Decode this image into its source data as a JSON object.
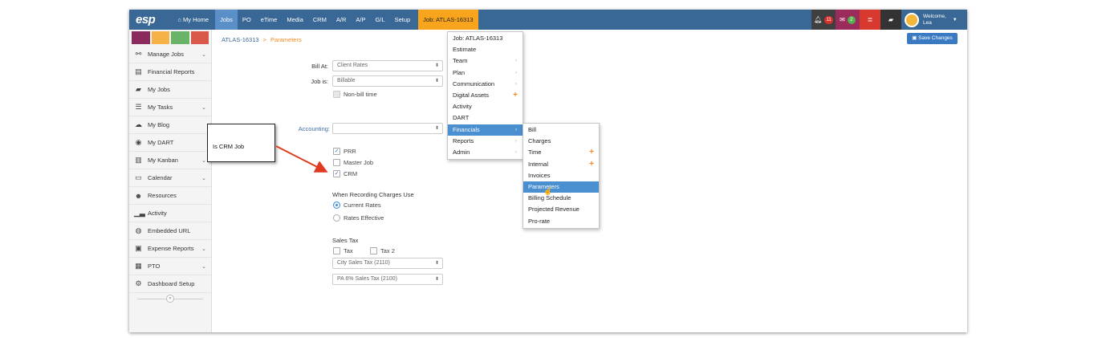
{
  "nav": {
    "logo": "esp",
    "home": "My Home",
    "items": [
      "Jobs",
      "PO",
      "eTime",
      "Media",
      "CRM",
      "A/R",
      "A/P",
      "G/L",
      "Setup"
    ],
    "job_tag": "Job: ATLAS-16313",
    "notif_count": "11",
    "mail_count": "2",
    "welcome_line1": "Welcome,",
    "welcome_line2": "Lea"
  },
  "sidebar": {
    "swatch_colors": [
      "#8b2a5c",
      "#f7b247",
      "#6ab46a",
      "#d9594a"
    ],
    "items": [
      {
        "label": "Manage Jobs",
        "icon": "sitemap-icon",
        "glyph": "⚯",
        "chevron": true
      },
      {
        "label": "Financial Reports",
        "icon": "report-icon",
        "glyph": "▤",
        "chevron": false
      },
      {
        "label": "My Jobs",
        "icon": "folder-icon",
        "glyph": "▰",
        "chevron": false
      },
      {
        "label": "My Tasks",
        "icon": "tasks-icon",
        "glyph": "☰",
        "chevron": true
      },
      {
        "label": "My Blog",
        "icon": "comments-icon",
        "glyph": "☁",
        "chevron": false
      },
      {
        "label": "My DART",
        "icon": "dart-icon",
        "glyph": "◉",
        "chevron": false
      },
      {
        "label": "My Kanban",
        "icon": "kanban-icon",
        "glyph": "▥",
        "chevron": true
      },
      {
        "label": "Calendar",
        "icon": "calendar-icon",
        "glyph": "▭",
        "chevron": true
      },
      {
        "label": "Resources",
        "icon": "users-icon",
        "glyph": "☻",
        "chevron": false
      },
      {
        "label": "Activity",
        "icon": "activity-icon",
        "glyph": "▁▃",
        "chevron": false
      },
      {
        "label": "Embedded URL",
        "icon": "globe-icon",
        "glyph": "◍",
        "chevron": false
      },
      {
        "label": "Expense Reports",
        "icon": "money-icon",
        "glyph": "▣",
        "chevron": true
      },
      {
        "label": "PTO",
        "icon": "pto-calendar-icon",
        "glyph": "▦",
        "chevron": true
      },
      {
        "label": "Dashboard Setup",
        "icon": "cogs-icon",
        "glyph": "⚙",
        "chevron": false
      }
    ],
    "collapse_glyph": "«"
  },
  "breadcrumb": {
    "job": "ATLAS-16313",
    "sep": ">",
    "current": "Parameters"
  },
  "save_label": "Save Changes",
  "form": {
    "bill_at_label": "Bill At:",
    "bill_at_value": "Client Rates",
    "job_is_label": "Job is:",
    "job_is_value": "Billable",
    "non_bill_label": "Non-bill time",
    "accounting_label": "Accounting:",
    "accounting_value": "",
    "prr_label": "PRR",
    "master_job_label": "Master Job",
    "crm_label": "CRM",
    "charges_heading": "When Recording Charges Use",
    "current_rates_label": "Current Rates",
    "rates_effective_label": "Rates Effective",
    "sales_tax_heading": "Sales Tax",
    "tax_label": "Tax",
    "tax2_label": "Tax 2",
    "tax_select_1": "City Sales Tax (2110)",
    "tax_select_2": "PA 6% Sales Tax (2100)"
  },
  "callout": {
    "text": "Is CRM Job"
  },
  "job_menu": {
    "items": [
      {
        "label": "Job: ATLAS-16313",
        "sub": false,
        "plus": false
      },
      {
        "label": "Estimate",
        "sub": false,
        "plus": false
      },
      {
        "label": "Team",
        "sub": true,
        "plus": false
      },
      {
        "label": "Plan",
        "sub": true,
        "plus": false
      },
      {
        "label": "Communication",
        "sub": true,
        "plus": false
      },
      {
        "label": "Digital Assets",
        "sub": false,
        "plus": true
      },
      {
        "label": "Activity",
        "sub": false,
        "plus": false
      },
      {
        "label": "DART",
        "sub": false,
        "plus": false
      },
      {
        "label": "Financials",
        "sub": true,
        "plus": false,
        "highlight": true
      },
      {
        "label": "Reports",
        "sub": true,
        "plus": false
      },
      {
        "label": "Admin",
        "sub": true,
        "plus": false
      }
    ]
  },
  "financials_menu": {
    "items": [
      {
        "label": "Bill",
        "plus": false
      },
      {
        "label": "Charges",
        "plus": false
      },
      {
        "label": "Time",
        "plus": true
      },
      {
        "label": "Internal",
        "plus": true
      },
      {
        "label": "Invoices",
        "plus": false
      },
      {
        "label": "Parameters",
        "plus": false,
        "highlight": true
      },
      {
        "label": "Billing Schedule",
        "plus": false
      },
      {
        "label": "Projected Revenue",
        "plus": false
      },
      {
        "label": "Pro-rate",
        "plus": false
      }
    ]
  }
}
